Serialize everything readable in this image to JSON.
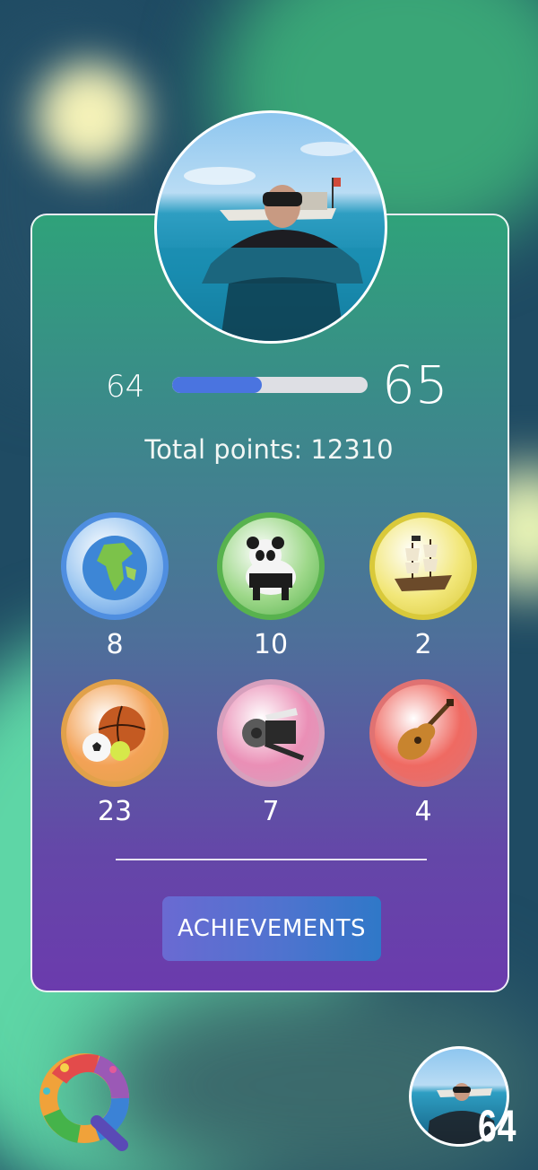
{
  "profile": {
    "current_level": "64",
    "next_level": "65",
    "progress_fraction": 0.46,
    "total_points_text": "Total points: 12310"
  },
  "categories": [
    {
      "icon": "globe-icon",
      "count": "8",
      "ring": "#4f8ee0",
      "fill": "#9cc7f1"
    },
    {
      "icon": "panda-icon",
      "count": "10",
      "ring": "#58b24e",
      "fill": "#9ed88a"
    },
    {
      "icon": "sailing-ship-icon",
      "count": "2",
      "ring": "#d9c93a",
      "fill": "#f2e77a"
    },
    {
      "icon": "sports-balls-icon",
      "count": "23",
      "ring": "#e1a14a",
      "fill": "#f3a256"
    },
    {
      "icon": "film-reel-icon",
      "count": "7",
      "ring": "#d7a0bd",
      "fill": "#ea8fb6"
    },
    {
      "icon": "guitar-icon",
      "count": "4",
      "ring": "#e07272",
      "fill": "#ef6a62"
    }
  ],
  "actions": {
    "achievements_label": "ACHIEVEMENTS"
  },
  "footer": {
    "player_level": "64"
  }
}
